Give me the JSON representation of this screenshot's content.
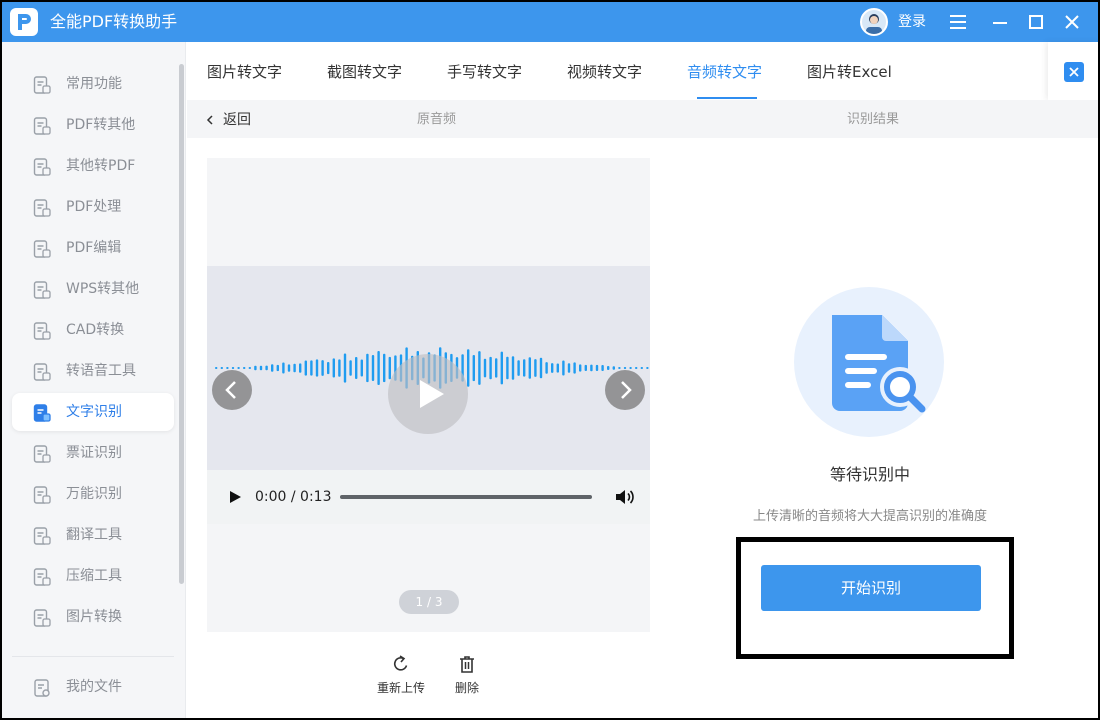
{
  "window": {
    "app_title": "全能PDF转换助手",
    "login_label": "登录",
    "accent_color": "#3d96ed"
  },
  "sidebar": {
    "items": [
      {
        "label": "常用功能",
        "icon": "common-functions-icon"
      },
      {
        "label": "PDF转其他",
        "icon": "pdf-to-other-icon"
      },
      {
        "label": "其他转PDF",
        "icon": "other-to-pdf-icon"
      },
      {
        "label": "PDF处理",
        "icon": "pdf-process-icon"
      },
      {
        "label": "PDF编辑",
        "icon": "pdf-edit-icon"
      },
      {
        "label": "WPS转其他",
        "icon": "wps-convert-icon"
      },
      {
        "label": "CAD转换",
        "icon": "cad-convert-icon"
      },
      {
        "label": "转语音工具",
        "icon": "text-to-speech-icon"
      },
      {
        "label": "文字识别",
        "icon": "text-recognition-icon",
        "active": true
      },
      {
        "label": "票证识别",
        "icon": "ticket-recognition-icon"
      },
      {
        "label": "万能识别",
        "icon": "universal-recognition-icon"
      },
      {
        "label": "翻译工具",
        "icon": "translate-icon"
      },
      {
        "label": "压缩工具",
        "icon": "compress-icon"
      },
      {
        "label": "图片转换",
        "icon": "image-convert-icon"
      }
    ],
    "my_files": {
      "label": "我的文件",
      "icon": "my-files-icon"
    }
  },
  "tabs": [
    {
      "label": "图片转文字"
    },
    {
      "label": "截图转文字"
    },
    {
      "label": "手写转文字"
    },
    {
      "label": "视频转文字"
    },
    {
      "label": "音频转文字",
      "active": true
    },
    {
      "label": "图片转Excel"
    }
  ],
  "subheader": {
    "back_label": "返回",
    "original_label": "原音频",
    "result_label": "识别结果"
  },
  "player": {
    "time": "0:00 / 0:13",
    "progress": 0,
    "page_indicator": "1 / 3"
  },
  "actions": {
    "reupload_label": "重新上传",
    "delete_label": "删除"
  },
  "result_panel": {
    "status_title": "等待识别中",
    "hint": "上传清晰的音频将大大提高识别的准确度",
    "start_button_label": "开始识别"
  }
}
